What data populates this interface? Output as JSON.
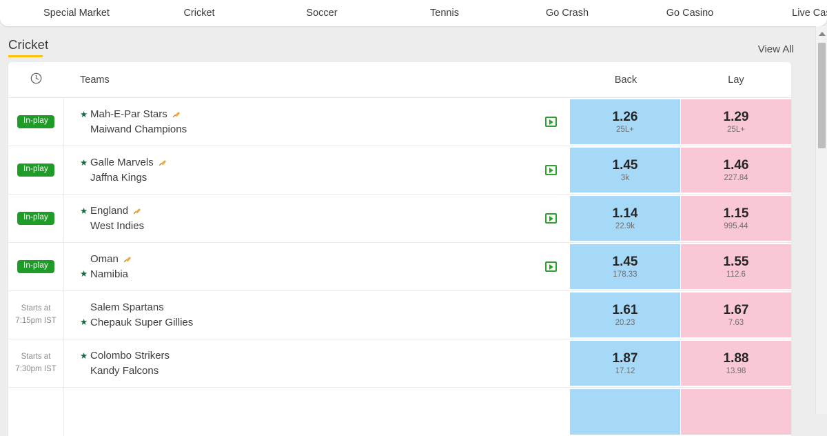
{
  "topnav": {
    "items": [
      {
        "label": "Special Market",
        "name": "nav-special-market"
      },
      {
        "label": "Cricket",
        "name": "nav-cricket"
      },
      {
        "label": "Soccer",
        "name": "nav-soccer"
      },
      {
        "label": "Tennis",
        "name": "nav-tennis"
      },
      {
        "label": "Go Crash",
        "name": "nav-go-crash"
      },
      {
        "label": "Go Casino",
        "name": "nav-go-casino"
      },
      {
        "label": "Live Casi",
        "name": "nav-live-casino"
      }
    ]
  },
  "section": {
    "title": "Cricket",
    "view_all": "View All",
    "accent_color": "#ffc107"
  },
  "table": {
    "headers": {
      "time_icon": "clock-icon",
      "teams": "Teams",
      "back": "Back",
      "lay": "Lay"
    },
    "colors": {
      "back_bg": "#a6d8f7",
      "lay_bg": "#f9c8d4",
      "inplay_bg": "#1f9c28",
      "star": "#126b3f",
      "tv_icon": "#2aa32a"
    },
    "rows": [
      {
        "status_type": "inplay",
        "status_label": "In-play",
        "starts_line1": "",
        "starts_line2": "",
        "team1": "Mah-E-Par Stars",
        "team2": "Maiwand Champions",
        "star_on": 1,
        "bat_on": 1,
        "tv": true,
        "back_odds": "1.26",
        "back_size": "25L+",
        "lay_odds": "1.29",
        "lay_size": "25L+"
      },
      {
        "status_type": "inplay",
        "status_label": "In-play",
        "starts_line1": "",
        "starts_line2": "",
        "team1": "Galle Marvels",
        "team2": "Jaffna Kings",
        "star_on": 1,
        "bat_on": 1,
        "tv": true,
        "back_odds": "1.45",
        "back_size": "3k",
        "lay_odds": "1.46",
        "lay_size": "227.84"
      },
      {
        "status_type": "inplay",
        "status_label": "In-play",
        "starts_line1": "",
        "starts_line2": "",
        "team1": "England",
        "team2": "West Indies",
        "star_on": 1,
        "bat_on": 1,
        "tv": true,
        "back_odds": "1.14",
        "back_size": "22.9k",
        "lay_odds": "1.15",
        "lay_size": "995.44"
      },
      {
        "status_type": "inplay",
        "status_label": "In-play",
        "starts_line1": "",
        "starts_line2": "",
        "team1": "Oman",
        "team2": "Namibia",
        "star_on": 2,
        "bat_on": 1,
        "tv": true,
        "back_odds": "1.45",
        "back_size": "178.33",
        "lay_odds": "1.55",
        "lay_size": "112.6"
      },
      {
        "status_type": "scheduled",
        "status_label": "",
        "starts_line1": "Starts at",
        "starts_line2": "7:15pm IST",
        "team1": "Salem Spartans",
        "team2": "Chepauk Super Gillies",
        "star_on": 2,
        "bat_on": 0,
        "tv": false,
        "back_odds": "1.61",
        "back_size": "20.23",
        "lay_odds": "1.67",
        "lay_size": "7.63"
      },
      {
        "status_type": "scheduled",
        "status_label": "",
        "starts_line1": "Starts at",
        "starts_line2": "7:30pm IST",
        "team1": "Colombo Strikers",
        "team2": "Kandy Falcons",
        "star_on": 1,
        "bat_on": 0,
        "tv": false,
        "back_odds": "1.87",
        "back_size": "17.12",
        "lay_odds": "1.88",
        "lay_size": "13.98"
      },
      {
        "status_type": "scheduled",
        "status_label": "",
        "starts_line1": "",
        "starts_line2": "",
        "team1": "",
        "team2": "",
        "star_on": 0,
        "bat_on": 0,
        "tv": false,
        "back_odds": "",
        "back_size": "",
        "lay_odds": "",
        "lay_size": ""
      }
    ]
  },
  "scrollbar": {
    "up_arrow": "chevron-up-icon"
  }
}
